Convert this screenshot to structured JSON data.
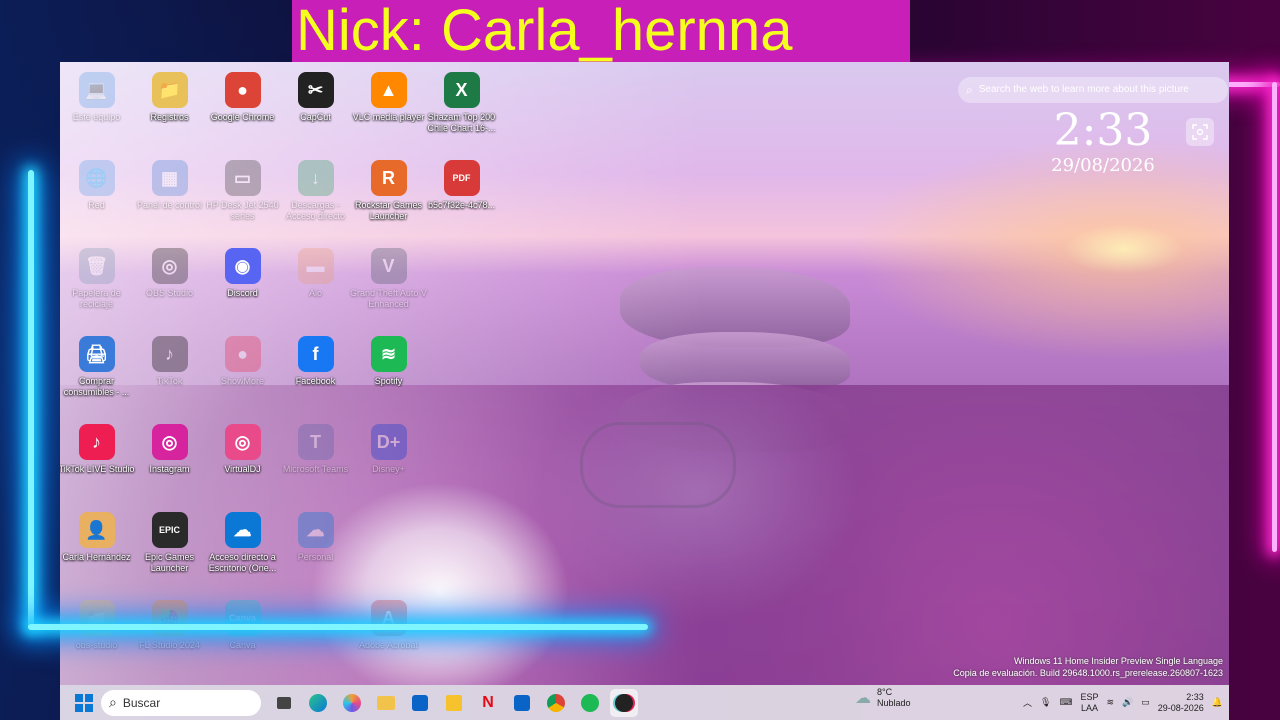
{
  "overlay": {
    "nick": "Nick: Carla_hernna"
  },
  "desktop_icons": [
    {
      "label": "Este equipo",
      "glyph": "💻",
      "color": "#6aa8e8",
      "faint": true,
      "col": 0,
      "row": 0
    },
    {
      "label": "Registros",
      "glyph": "📁",
      "color": "#e8c15a",
      "faint": false,
      "col": 1,
      "row": 0
    },
    {
      "label": "Google Chrome",
      "glyph": "●",
      "color": "#db4437",
      "faint": false,
      "col": 2,
      "row": 0
    },
    {
      "label": "CapCut",
      "glyph": "✂",
      "color": "#222222",
      "faint": false,
      "col": 3,
      "row": 0
    },
    {
      "label": "VLC media player",
      "glyph": "▲",
      "color": "#ff8800",
      "faint": false,
      "col": 4,
      "row": 0
    },
    {
      "label": "Shazam Top 200 Chile Chart 16-...",
      "glyph": "X",
      "color": "#1d7a45",
      "faint": false,
      "col": 5,
      "row": 0
    },
    {
      "label": "Red",
      "glyph": "🌐",
      "color": "#6aa8e8",
      "faint": true,
      "col": 0,
      "row": 1
    },
    {
      "label": "Panel de control",
      "glyph": "▦",
      "color": "#5a8fd8",
      "faint": true,
      "col": 1,
      "row": 1
    },
    {
      "label": "HP Desk Jet 2540 series",
      "glyph": "▭",
      "color": "#4a4a4a",
      "faint": true,
      "col": 2,
      "row": 1
    },
    {
      "label": "Descargas - Acceso directo",
      "glyph": "↓",
      "color": "#3aa86b",
      "faint": true,
      "col": 3,
      "row": 1
    },
    {
      "label": "Rockstar Games Launcher",
      "glyph": "R",
      "color": "#e86a2a",
      "faint": false,
      "col": 4,
      "row": 1
    },
    {
      "label": "b5c7f32e-4c78...",
      "glyph": "PDF",
      "color": "#d83a3a",
      "faint": false,
      "col": 5,
      "row": 1
    },
    {
      "label": "Papelera de reciclaje",
      "glyph": "🗑",
      "color": "#8aa0b8",
      "faint": true,
      "col": 0,
      "row": 2
    },
    {
      "label": "OBS Studio",
      "glyph": "◎",
      "color": "#2a2a2a",
      "faint": true,
      "col": 1,
      "row": 2
    },
    {
      "label": "Discord",
      "glyph": "◉",
      "color": "#5865f2",
      "faint": false,
      "col": 2,
      "row": 2
    },
    {
      "label": "Alo",
      "glyph": "▬",
      "color": "#e8a080",
      "faint": true,
      "col": 3,
      "row": 2
    },
    {
      "label": "Grand Theft Auto V Enhanced",
      "glyph": "V",
      "color": "#556070",
      "faint": true,
      "col": 4,
      "row": 2
    },
    {
      "label": "Comprar consumibles - ...",
      "glyph": "🖨",
      "color": "#3a7ad8",
      "faint": false,
      "col": 0,
      "row": 3
    },
    {
      "label": "TikTok",
      "glyph": "♪",
      "color": "#111111",
      "faint": true,
      "col": 1,
      "row": 3
    },
    {
      "label": "ShowMore",
      "glyph": "●",
      "color": "#e83a5a",
      "faint": true,
      "col": 2,
      "row": 3
    },
    {
      "label": "Facebook",
      "glyph": "f",
      "color": "#1877f2",
      "faint": false,
      "col": 3,
      "row": 3
    },
    {
      "label": "Spotify",
      "glyph": "≋",
      "color": "#1db954",
      "faint": false,
      "col": 4,
      "row": 3
    },
    {
      "label": "TikTok LIVE Studio",
      "glyph": "♪",
      "color": "#ee1d52",
      "faint": false,
      "col": 0,
      "row": 4
    },
    {
      "label": "Instagram",
      "glyph": "◎",
      "color": "#d6249f",
      "faint": false,
      "col": 1,
      "row": 4
    },
    {
      "label": "VirtualDJ",
      "glyph": "◎",
      "color": "#e84a8a",
      "faint": false,
      "col": 2,
      "row": 4
    },
    {
      "label": "Microsoft Teams",
      "glyph": "T",
      "color": "#6264a7",
      "faint": true,
      "col": 3,
      "row": 4
    },
    {
      "label": "Disney+",
      "glyph": "D+",
      "color": "#113ccf",
      "faint": true,
      "col": 4,
      "row": 4
    },
    {
      "label": "Carla Hernández",
      "glyph": "👤",
      "color": "#e8b060",
      "faint": false,
      "col": 0,
      "row": 5
    },
    {
      "label": "Epic Games Launcher",
      "glyph": "EPIC",
      "color": "#2a2a2a",
      "faint": false,
      "col": 1,
      "row": 5
    },
    {
      "label": "Acceso directo a Escritorio (One...",
      "glyph": "☁",
      "color": "#0a78d4",
      "faint": false,
      "col": 2,
      "row": 5
    },
    {
      "label": "Personal",
      "glyph": "☁",
      "color": "#0a78d4",
      "faint": true,
      "col": 3,
      "row": 5
    },
    {
      "label": "obs-studio",
      "glyph": "📁",
      "color": "#e8c15a",
      "faint": true,
      "col": 0,
      "row": 6
    },
    {
      "label": "FL Studio 2024",
      "glyph": "🍓",
      "color": "#f08a20",
      "faint": true,
      "col": 1,
      "row": 6
    },
    {
      "label": "Canva",
      "glyph": "Canva",
      "color": "#20c4cb",
      "faint": true,
      "col": 2,
      "row": 6
    },
    {
      "label": "Adobe Acrobat",
      "glyph": "A",
      "color": "#d83a3a",
      "faint": true,
      "col": 4,
      "row": 6
    }
  ],
  "lens": {
    "text": "Search the web to learn more about this picture"
  },
  "lock_clock": {
    "time": "2:33",
    "date": "29/08/2026"
  },
  "watermark": {
    "line1": "Windows 11 Home Insider Preview Single Language",
    "line2": "Copia de evaluación. Build 29648.1000.rs_prerelease.260807-1623"
  },
  "taskbar": {
    "search_placeholder": "Buscar",
    "weather_temp": "8°C",
    "weather_desc": "Nublado",
    "lang_1": "ESP",
    "lang_2": "LAA",
    "time": "2:33",
    "date": "29-08-2026"
  }
}
